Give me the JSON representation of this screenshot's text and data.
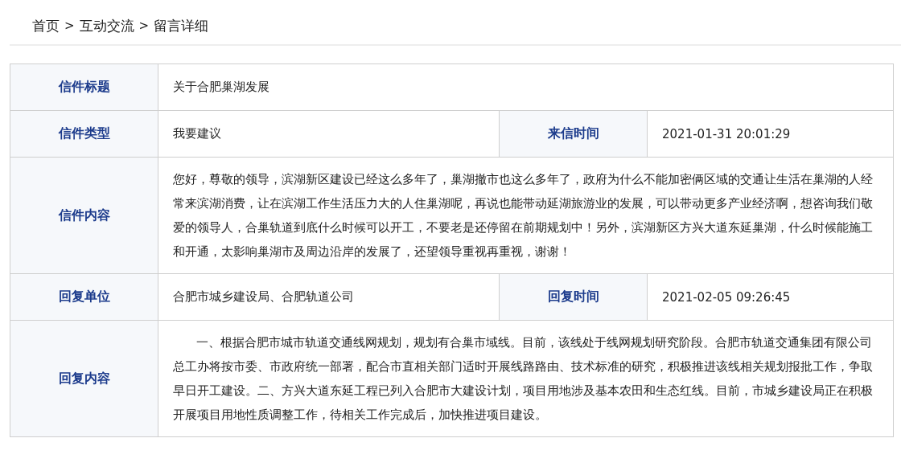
{
  "breadcrumb": [
    {
      "kind": "link",
      "text": "首页"
    },
    {
      "kind": "separator",
      "text": ">"
    },
    {
      "kind": "link",
      "text": "互动交流"
    },
    {
      "kind": "separator",
      "text": ">"
    },
    {
      "kind": "current",
      "text": "留言详细"
    }
  ],
  "rows": [
    {
      "cells": [
        {
          "kind": "label",
          "text": "信件标题"
        },
        {
          "kind": "value",
          "text": "关于合肥巢湖发展"
        }
      ]
    },
    {
      "cells": [
        {
          "kind": "label",
          "text": "信件类型"
        },
        {
          "kind": "value",
          "text": "我要建议"
        },
        {
          "kind": "label",
          "text": "来信时间"
        },
        {
          "kind": "value",
          "text": "2021-01-31 20:01:29"
        }
      ]
    },
    {
      "cells": [
        {
          "kind": "label",
          "text": "信件内容"
        },
        {
          "kind": "paragraph",
          "text": "您好，尊敬的领导，滨湖新区建设已经这么多年了，巢湖撤市也这么多年了，政府为什么不能加密俩区域的交通让生活在巢湖的人经常来滨湖消费，让在滨湖工作生活压力大的人住巢湖呢，再说也能带动延湖旅游业的发展，可以带动更多产业经济啊，想咨询我们敬爱的领导人，合巢轨道到底什么时候可以开工，不要老是还停留在前期规划中！另外，滨湖新区方兴大道东延巢湖，什么时候能施工和开通，太影响巢湖市及周边沿岸的发展了，还望领导重视再重视，谢谢！"
        }
      ]
    },
    {
      "cells": [
        {
          "kind": "label",
          "text": "回复单位"
        },
        {
          "kind": "value",
          "text": "合肥市城乡建设局、合肥轨道公司"
        },
        {
          "kind": "label",
          "text": "回复时间"
        },
        {
          "kind": "value",
          "text": "2021-02-05 09:26:45"
        }
      ]
    },
    {
      "cells": [
        {
          "kind": "label",
          "text": "回复内容"
        },
        {
          "kind": "indented",
          "text": "一、根据合肥市城市轨道交通线网规划，规划有合巢市域线。目前，该线处于线网规划研究阶段。合肥市轨道交通集团有限公司总工办将按市委、市政府统一部署，配合市直相关部门适时开展线路路由、技术标准的研究，积极推进该线相关规划报批工作，争取早日开工建设。二、方兴大道东延工程已列入合肥市大建设计划，项目用地涉及基本农田和生态红线。目前，市城乡建设局正在积极开展项目用地性质调整工作，待相关工作完成后，加快推进项目建设。"
        }
      ]
    }
  ]
}
